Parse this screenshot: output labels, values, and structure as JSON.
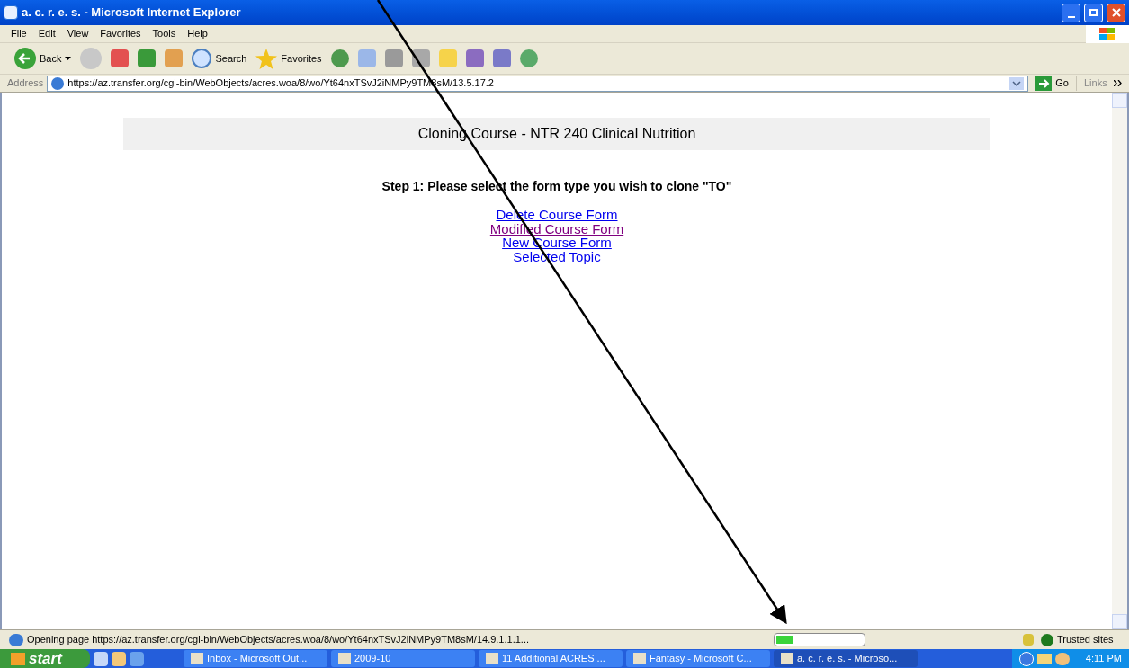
{
  "window": {
    "title": "a. c. r. e. s. - Microsoft Internet Explorer"
  },
  "menu": [
    "File",
    "Edit",
    "View",
    "Favorites",
    "Tools",
    "Help"
  ],
  "toolbar": {
    "back": "Back",
    "search": "Search",
    "favorites": "Favorites"
  },
  "address_bar": {
    "label": "Address",
    "url": "https://az.transfer.org/cgi-bin/WebObjects/acres.woa/8/wo/Yt64nxTSvJ2iNMPy9TM8sM/13.5.17.2",
    "go": "Go",
    "links": "Links"
  },
  "page": {
    "heading": "Cloning Course - NTR 240 Clinical Nutrition",
    "step": "Step 1: Please select the form type you wish to clone \"TO\"",
    "links": [
      {
        "label": "Delete Course Form",
        "visited": false
      },
      {
        "label": "Modified Course Form",
        "visited": true
      },
      {
        "label": "New Course Form",
        "visited": false
      },
      {
        "label": "Selected Topic",
        "visited": false
      }
    ]
  },
  "status_bar": {
    "text": "Opening page https://az.transfer.org/cgi-bin/WebObjects/acres.woa/8/wo/Yt64nxTSvJ2iNMPy9TM8sM/14.9.1.1.1...",
    "level": 0.2,
    "zone": "Trusted sites"
  },
  "taskbar": {
    "start": "start",
    "tasks": [
      {
        "label": "Inbox - Microsoft Out...",
        "selected": false
      },
      {
        "label": "2009-10",
        "selected": false
      },
      {
        "label": "11 Additional ACRES ...",
        "selected": false
      },
      {
        "label": "Fantasy - Microsoft C...",
        "selected": false
      },
      {
        "label": "a. c. r. e. s. - Microso...",
        "selected": true
      }
    ],
    "clock": "4:11 PM"
  }
}
